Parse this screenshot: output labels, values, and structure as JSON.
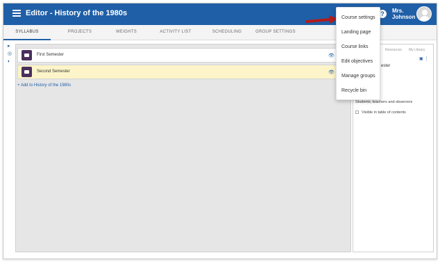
{
  "header": {
    "title": "Editor - History of the 1980s",
    "help_icon": "?",
    "user_name_line1": "Mrs.",
    "user_name_line2": "Johnson"
  },
  "tabs": [
    {
      "label": "SYLLABUS",
      "active": true
    },
    {
      "label": "PROJECTS",
      "active": false
    },
    {
      "label": "WEIGHTS",
      "active": false
    },
    {
      "label": "ACTIVITY LIST",
      "active": false
    },
    {
      "label": "SCHEDULING",
      "active": false
    },
    {
      "label": "GROUP SETTINGS",
      "active": false
    }
  ],
  "syllabus": {
    "items": [
      {
        "label": "First Semester",
        "highlighted": false
      },
      {
        "label": "Second Semester",
        "highlighted": true
      }
    ],
    "add_link": "Add to History of the 1980s"
  },
  "right_panel": {
    "tabs": [
      "Resources",
      "My Library"
    ],
    "title_fragment": "ester",
    "visibility_text": "Students, teachers and observers",
    "checkbox_label": "Visible in table of contents"
  },
  "dropdown_menu": {
    "items": [
      "Course settings",
      "Landing page",
      "Course links",
      "Edit objectives",
      "Manage groups",
      "Recycle bin"
    ]
  },
  "colors": {
    "topbar": "#1f5fa8",
    "highlight_row": "#fdf5c9",
    "folder": "#4a2f5c",
    "arrow": "#b01c1c"
  },
  "icons": {
    "menu": "hamburger-icon",
    "help": "help-icon",
    "visibility": "eye-icon",
    "edit": "pencil-icon"
  }
}
